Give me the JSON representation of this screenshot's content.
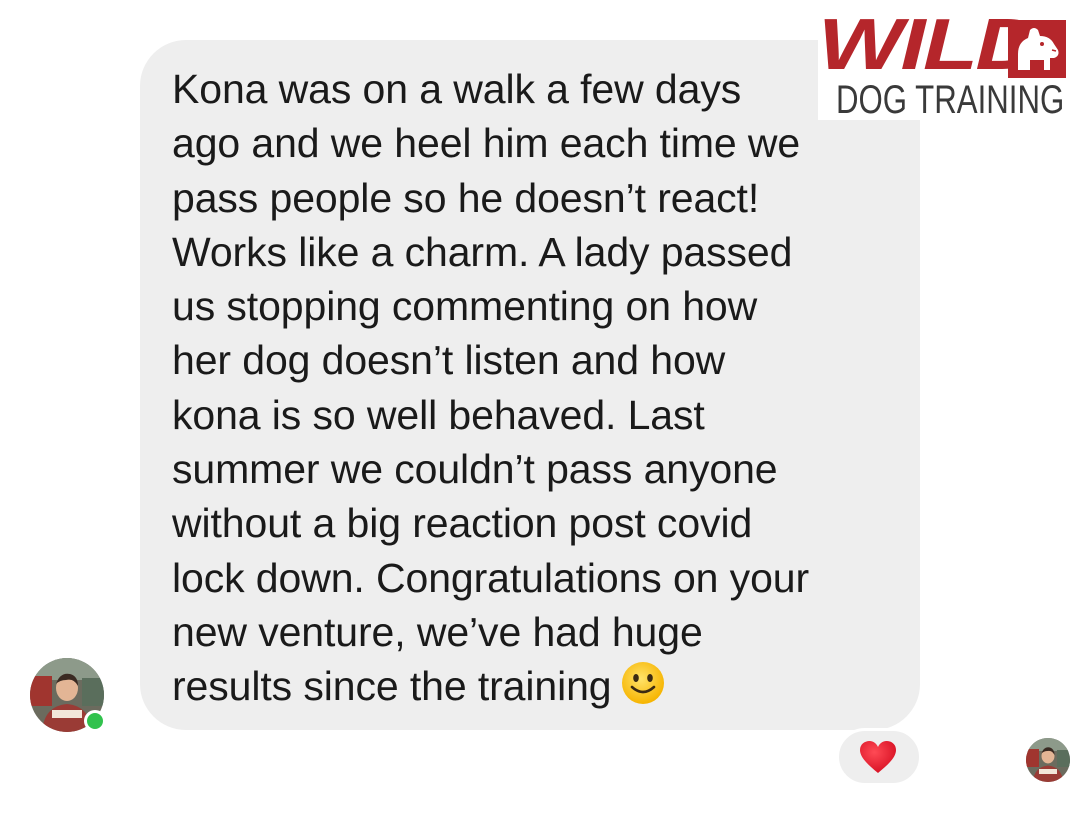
{
  "brand": {
    "logo_word": "WILD",
    "logo_subtitle": "DOG TRAINING",
    "logo_color": "#b5262b",
    "logo_icon": "bulldog-icon"
  },
  "message": {
    "text": "Kona was on a walk a few days\nago and we heel him each time we\npass people so he doesn’t react!\nWorks like a charm. A lady passed\nus stopping commenting on how\nher dog doesn’t listen and how\nkona is so well behaved. Last\nsummer we couldn’t pass anyone\nwithout a big reaction post covid\nlock down. Congratulations on your\nnew venture, we’ve had huge\nresults since the training",
    "emoji": "slightly-smiling-face-icon",
    "bubble_color": "#eeeeee"
  },
  "sender": {
    "avatar": "sender-avatar",
    "online": true,
    "status_color": "#31c24d"
  },
  "reaction": {
    "icon": "red-heart-icon",
    "color": "#e8192c"
  },
  "reader": {
    "avatar": "read-receipt-avatar"
  }
}
